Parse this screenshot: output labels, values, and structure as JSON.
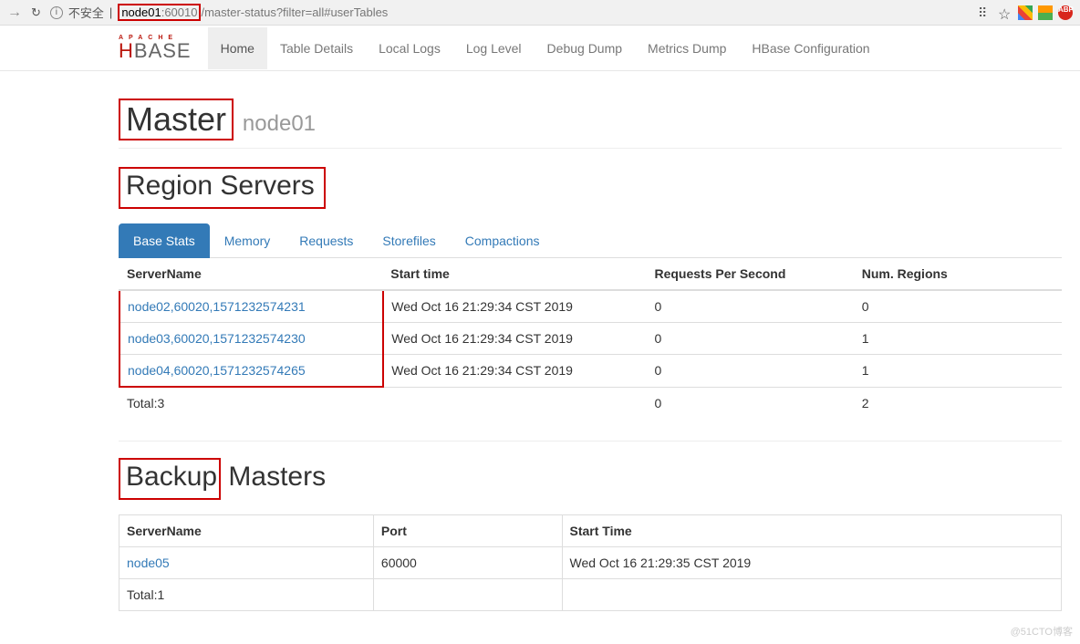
{
  "browser": {
    "insecure_label": "不安全",
    "url_host": "node01",
    "url_port": ":60010",
    "url_path": "/master-status?filter=all#userTables",
    "translate_icon": "translate-icon",
    "star_icon": "star-icon"
  },
  "logo": {
    "top": "APACHE",
    "main_h": "H",
    "main_rest": "BASE"
  },
  "nav": {
    "items": [
      {
        "label": "Home",
        "active": true
      },
      {
        "label": "Table Details",
        "active": false
      },
      {
        "label": "Local Logs",
        "active": false
      },
      {
        "label": "Log Level",
        "active": false
      },
      {
        "label": "Debug Dump",
        "active": false
      },
      {
        "label": "Metrics Dump",
        "active": false
      },
      {
        "label": "HBase Configuration",
        "active": false
      }
    ]
  },
  "header": {
    "title": "Master",
    "subtitle": "node01"
  },
  "region_servers": {
    "heading": "Region Servers",
    "tabs": [
      {
        "label": "Base Stats",
        "active": true
      },
      {
        "label": "Memory"
      },
      {
        "label": "Requests"
      },
      {
        "label": "Storefiles"
      },
      {
        "label": "Compactions"
      }
    ],
    "columns": [
      "ServerName",
      "Start time",
      "Requests Per Second",
      "Num. Regions"
    ],
    "rows": [
      {
        "server": "node02,60020,1571232574231",
        "start": "Wed Oct 16 21:29:34 CST 2019",
        "rps": "0",
        "regions": "0"
      },
      {
        "server": "node03,60020,1571232574230",
        "start": "Wed Oct 16 21:29:34 CST 2019",
        "rps": "0",
        "regions": "1"
      },
      {
        "server": "node04,60020,1571232574265",
        "start": "Wed Oct 16 21:29:34 CST 2019",
        "rps": "0",
        "regions": "1"
      }
    ],
    "total": {
      "label": "Total:3",
      "rps": "0",
      "regions": "2"
    }
  },
  "backup_masters": {
    "heading_part1": "Backup",
    "heading_part2": " Masters",
    "columns": [
      "ServerName",
      "Port",
      "Start Time"
    ],
    "rows": [
      {
        "server": "node05",
        "port": "60000",
        "start": "Wed Oct 16 21:29:35 CST 2019"
      }
    ],
    "total": {
      "label": "Total:1"
    }
  },
  "watermark": "@51CTO博客"
}
